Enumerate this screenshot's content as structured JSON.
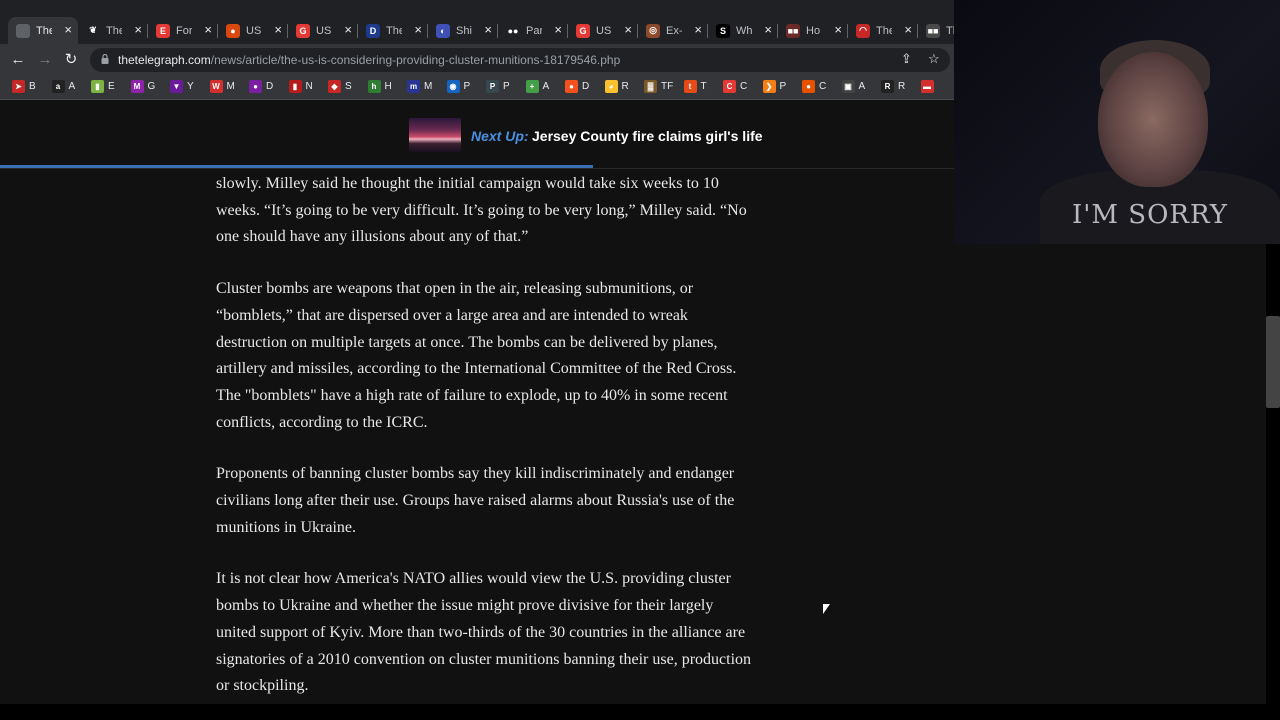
{
  "tabs": [
    {
      "title": "The",
      "fav": "",
      "color": "#5f6368"
    },
    {
      "title": "The",
      "fav": "❦",
      "color": "#202124"
    },
    {
      "title": "For",
      "fav": "E",
      "color": "#e53935"
    },
    {
      "title": "US",
      "fav": "●",
      "color": "#d9480f"
    },
    {
      "title": "US",
      "fav": "G",
      "color": "#e53935"
    },
    {
      "title": "The",
      "fav": "D",
      "color": "#1e3a8a"
    },
    {
      "title": "Shi",
      "fav": "◐",
      "color": "#3f51b5"
    },
    {
      "title": "Par",
      "fav": "●●",
      "color": "#202124"
    },
    {
      "title": "US",
      "fav": "G",
      "color": "#e53935"
    },
    {
      "title": "Ex-",
      "fav": "◎",
      "color": "#8d4a2a"
    },
    {
      "title": "Wh",
      "fav": "S",
      "color": "#000000"
    },
    {
      "title": "Ho",
      "fav": "■■",
      "color": "#6a2a2a"
    },
    {
      "title": "The",
      "fav": "◠",
      "color": "#c62828"
    },
    {
      "title": "Th",
      "fav": "■■",
      "color": "#4a4a4a"
    }
  ],
  "toolbar": {
    "url_domain": "thetelegraph.com",
    "url_path": "/news/article/the-us-is-considering-providing-cluster-munitions-18179546.php",
    "back_icon": "←",
    "forward_icon": "→",
    "reload_icon": "↻",
    "share_icon": "⇪",
    "star_icon": "☆"
  },
  "bookmarks": [
    {
      "label": "B",
      "icon": "➤",
      "color": "#c62828"
    },
    {
      "label": "A",
      "icon": "a",
      "color": "#222"
    },
    {
      "label": "E",
      "icon": "▮",
      "color": "#7cb342"
    },
    {
      "label": "G",
      "icon": "M",
      "color": "#8e24aa"
    },
    {
      "label": "Y",
      "icon": "▼",
      "color": "#6a1b9a"
    },
    {
      "label": "M",
      "icon": "W",
      "color": "#d32f2f"
    },
    {
      "label": "D",
      "icon": "●",
      "color": "#7b1fa2"
    },
    {
      "label": "N",
      "icon": "▮",
      "color": "#b71c1c"
    },
    {
      "label": "S",
      "icon": "◆",
      "color": "#c62828"
    },
    {
      "label": "H",
      "icon": "h",
      "color": "#2e7d32"
    },
    {
      "label": "M",
      "icon": "m",
      "color": "#283593"
    },
    {
      "label": "P",
      "icon": "◉",
      "color": "#1565c0"
    },
    {
      "label": "P",
      "icon": "P",
      "color": "#37474f"
    },
    {
      "label": "A",
      "icon": "+",
      "color": "#43a047"
    },
    {
      "label": "D",
      "icon": "●",
      "color": "#f4511e"
    },
    {
      "label": "R",
      "icon": "◕",
      "color": "#fbc02d"
    },
    {
      "label": "TF",
      "icon": "▓",
      "color": "#7b5a2a"
    },
    {
      "label": "T",
      "icon": "t",
      "color": "#e64a19"
    },
    {
      "label": "C",
      "icon": "C",
      "color": "#e53935"
    },
    {
      "label": "P",
      "icon": "❯",
      "color": "#f57f17"
    },
    {
      "label": "C",
      "icon": "●",
      "color": "#e65100"
    },
    {
      "label": "A",
      "icon": "▣",
      "color": "#424242"
    },
    {
      "label": "R",
      "icon": "R",
      "color": "#212121"
    },
    {
      "label": "",
      "icon": "▬",
      "color": "#d32f2f"
    }
  ],
  "nextup": {
    "label": "Next Up:",
    "title": "Jersey County fire claims girl's life"
  },
  "article": {
    "paragraphs": [
      "slowly. Milley said he thought the initial campaign would take six weeks to 10 weeks. “It’s going to be very difficult. It’s going to be very long,” Milley said. “No one should have any illusions about any of that.”",
      "Cluster bombs are weapons that open in the air, releasing submunitions, or “bomblets,” that are dispersed over a large area and are intended to wreak destruction on multiple targets at once. The bombs can be delivered by planes, artillery and missiles, according to the International Committee of the Red Cross. The \"bomblets\" have a high rate of failure to explode, up to 40% in some recent conflicts, according to the ICRC.",
      "Proponents of banning cluster bombs say they kill indiscriminately and endanger civilians long after their use. Groups have raised alarms about Russia's use of the munitions in Ukraine.",
      "It is not clear how America's NATO allies would view the U.S. providing cluster bombs to Ukraine and whether the issue might prove divisive for their largely united support of Kyiv. More than two-thirds of the 30 countries in the alliance are signatories of a 2010 convention on cluster munitions banning their use, production or stockpiling."
    ]
  },
  "webcam": {
    "shirt_text": "I'M SORRY"
  }
}
